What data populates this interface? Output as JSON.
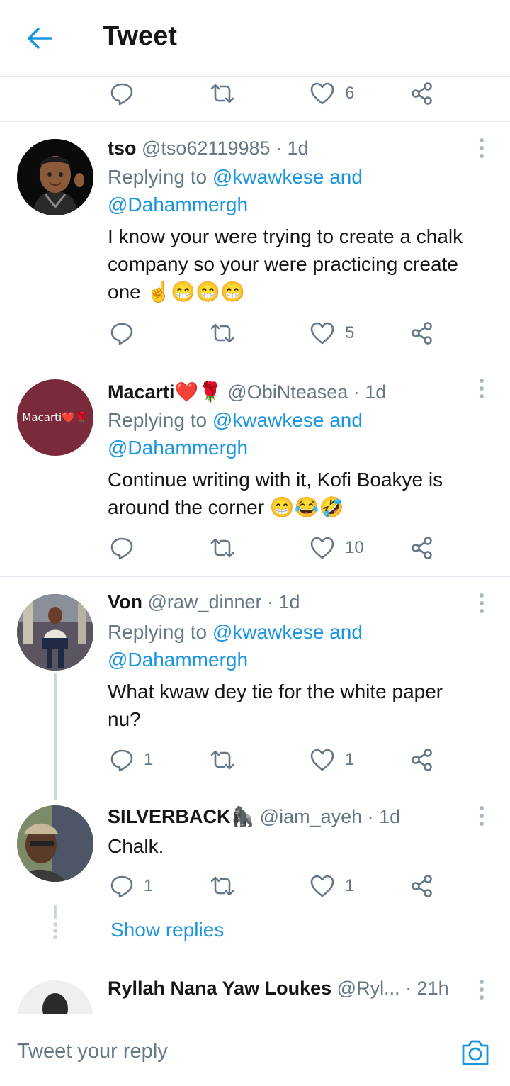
{
  "header": {
    "title": "Tweet"
  },
  "top_actions": {
    "reply_count": "",
    "retweet_count": "",
    "like_count": "6"
  },
  "tweets": [
    {
      "name": "tso",
      "handle": "@tso62119985 · 1d",
      "replying_prefix": "Replying to ",
      "replying_users": "@kwawkese and",
      "replying_users2": "@Dahammergh",
      "text": "I know your were trying to create a chalk company so your were practicing create one ☝😁😁😁",
      "reply_count": "",
      "retweet_count": "",
      "like_count": "5"
    },
    {
      "name": "Macarti❤️🌹",
      "handle": "@ObiNteasea · 1d",
      "avatar_text": "Macarti❤️🌹",
      "replying_prefix": "Replying to ",
      "replying_users": "@kwawkese and",
      "replying_users2": "@Dahammergh",
      "text": "Continue writing with it, Kofi Boakye is around the corner 😁😂🤣",
      "reply_count": "",
      "retweet_count": "",
      "like_count": "10"
    },
    {
      "name": "Von",
      "handle": "@raw_dinner · 1d",
      "replying_prefix": "Replying to ",
      "replying_users": "@kwawkese and",
      "replying_users2": "@Dahammergh",
      "text": "What kwaw dey tie for the white paper nu?",
      "reply_count": "1",
      "retweet_count": "",
      "like_count": "1"
    },
    {
      "name": "SILVERBACK🦍",
      "handle": "@iam_ayeh · 1d",
      "text": "Chalk.",
      "reply_count": "1",
      "retweet_count": "",
      "like_count": "1"
    },
    {
      "name": "Ryllah Nana Yaw Loukes",
      "handle": "@Ryl... · 21h"
    }
  ],
  "show_replies": "Show replies",
  "compose": {
    "placeholder": "Tweet your reply"
  },
  "colors": {
    "accent": "#1b95e0",
    "muted": "#657786",
    "border": "#e1e8ed"
  },
  "icons": [
    "back-arrow-icon",
    "reply-icon",
    "retweet-icon",
    "like-icon",
    "share-icon",
    "more-icon",
    "camera-icon"
  ]
}
